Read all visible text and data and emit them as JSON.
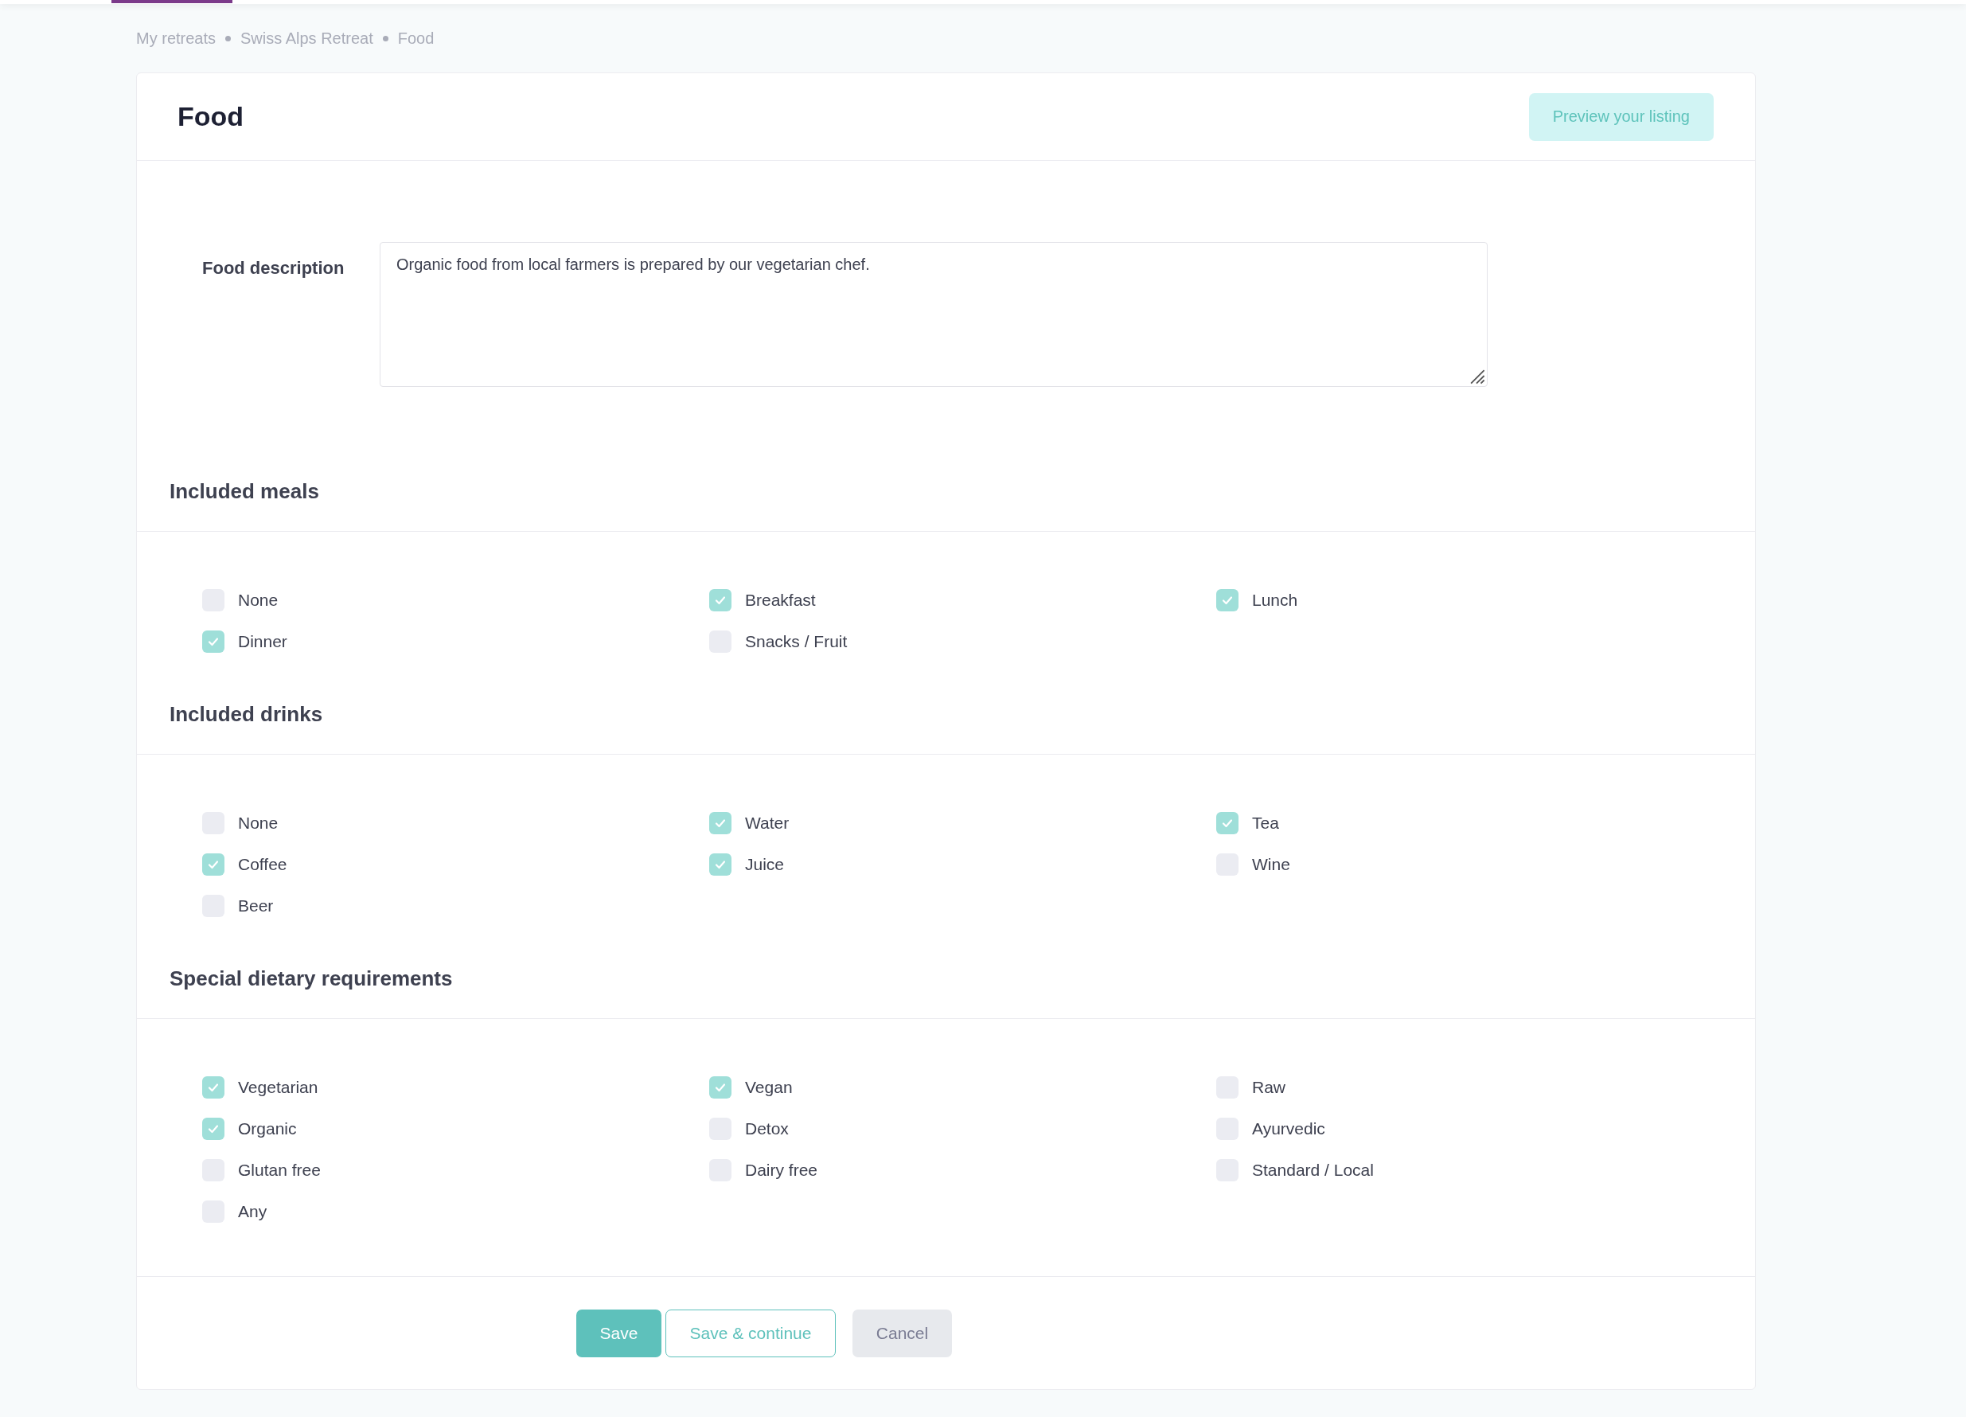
{
  "breadcrumb": [
    "My retreats",
    "Swiss Alps Retreat",
    "Food"
  ],
  "page": {
    "title": "Food",
    "preview_button": "Preview your listing"
  },
  "description": {
    "label": "Food description",
    "value": "Organic food from local farmers is prepared by our vegetarian chef."
  },
  "sections": [
    {
      "title": "Included meals",
      "options": [
        {
          "label": "None",
          "checked": false
        },
        {
          "label": "Breakfast",
          "checked": true
        },
        {
          "label": "Lunch",
          "checked": true
        },
        {
          "label": "Dinner",
          "checked": true
        },
        {
          "label": "Snacks / Fruit",
          "checked": false
        }
      ]
    },
    {
      "title": "Included drinks",
      "options": [
        {
          "label": "None",
          "checked": false
        },
        {
          "label": "Water",
          "checked": true
        },
        {
          "label": "Tea",
          "checked": true
        },
        {
          "label": "Coffee",
          "checked": true
        },
        {
          "label": "Juice",
          "checked": true
        },
        {
          "label": "Wine",
          "checked": false
        },
        {
          "label": "Beer",
          "checked": false
        }
      ]
    },
    {
      "title": "Special dietary requirements",
      "options": [
        {
          "label": "Vegetarian",
          "checked": true
        },
        {
          "label": "Vegan",
          "checked": true
        },
        {
          "label": "Raw",
          "checked": false
        },
        {
          "label": "Organic",
          "checked": true
        },
        {
          "label": "Detox",
          "checked": false
        },
        {
          "label": "Ayurvedic",
          "checked": false
        },
        {
          "label": "Glutan free",
          "checked": false
        },
        {
          "label": "Dairy free",
          "checked": false
        },
        {
          "label": "Standard / Local",
          "checked": false
        },
        {
          "label": "Any",
          "checked": false
        }
      ]
    }
  ],
  "buttons": {
    "save": "Save",
    "save_continue": "Save & continue",
    "cancel": "Cancel"
  }
}
